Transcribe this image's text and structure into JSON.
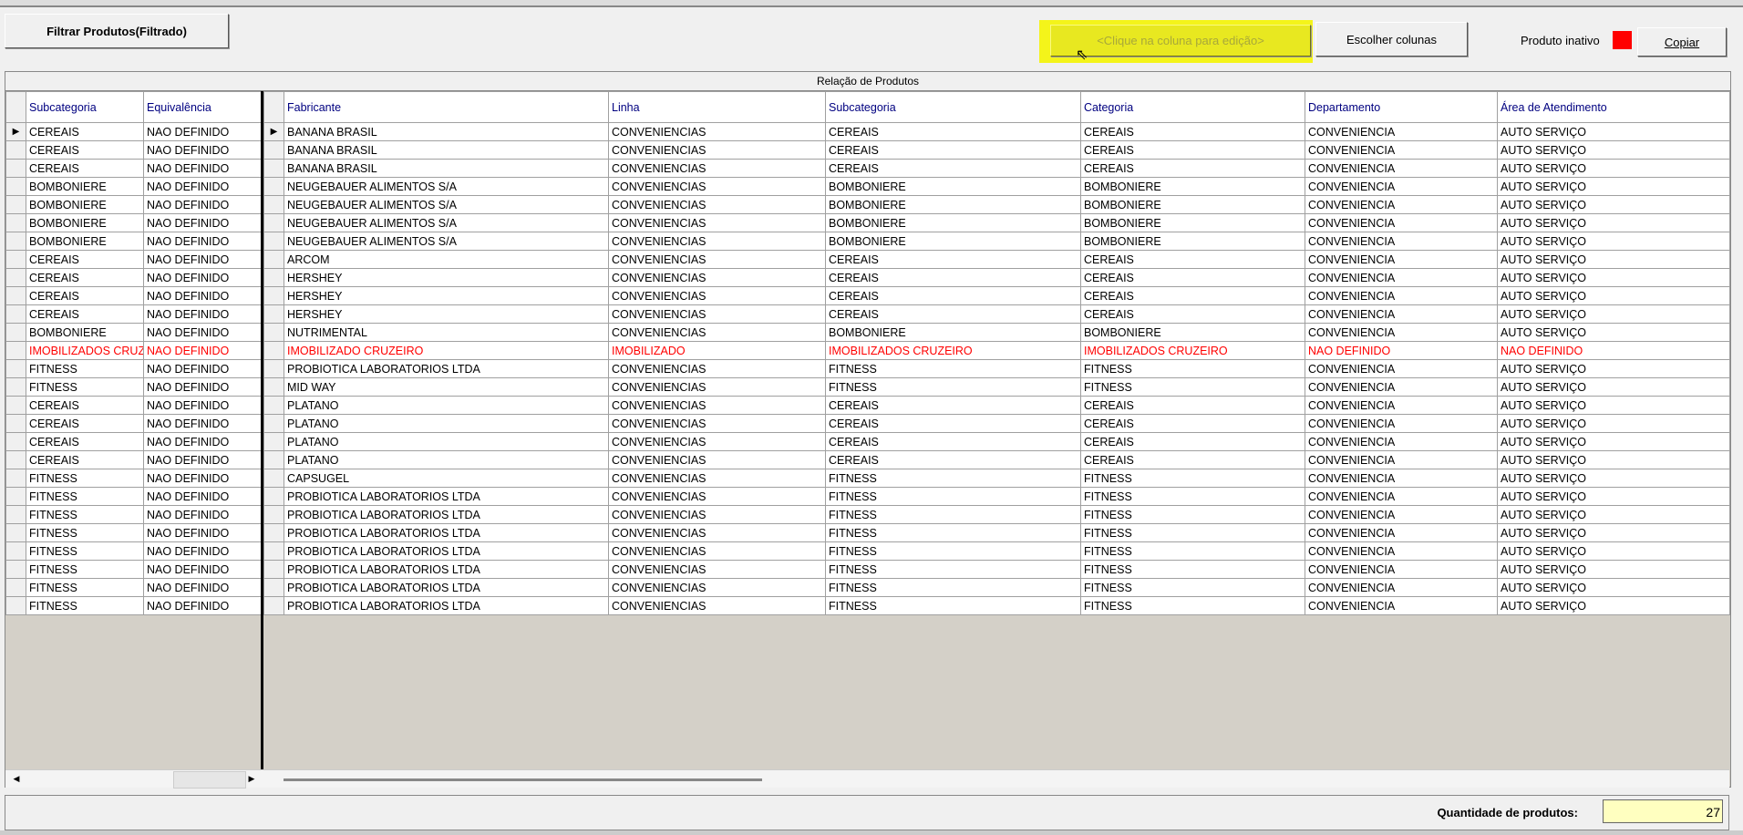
{
  "toolbar": {
    "filter_label": "Filtrar Produtos(Filtrado)",
    "edit_hint": "<Clique na coluna para edição>",
    "choose_columns": "Escolher colunas",
    "inactive_label": "Produto inativo",
    "inactive_color": "#ff0000",
    "copy_label": "Copiar"
  },
  "grid": {
    "title": "Relação de Produtos",
    "fixed_headers": [
      "Subcategoria",
      "Equivalência"
    ],
    "headers": [
      "Fabricante",
      "Linha",
      "Subcategoria",
      "Categoria",
      "Departamento",
      "Área de Atendimento"
    ],
    "rows": [
      [
        "CEREAIS",
        "NAO DEFINIDO",
        "BANANA BRASIL",
        "CONVENIENCIAS",
        "CEREAIS",
        "CEREAIS",
        "CONVENIENCIA",
        "AUTO SERVIÇO"
      ],
      [
        "CEREAIS",
        "NAO DEFINIDO",
        "BANANA BRASIL",
        "CONVENIENCIAS",
        "CEREAIS",
        "CEREAIS",
        "CONVENIENCIA",
        "AUTO SERVIÇO"
      ],
      [
        "CEREAIS",
        "NAO DEFINIDO",
        "BANANA BRASIL",
        "CONVENIENCIAS",
        "CEREAIS",
        "CEREAIS",
        "CONVENIENCIA",
        "AUTO SERVIÇO"
      ],
      [
        "BOMBONIERE",
        "NAO DEFINIDO",
        "NEUGEBAUER ALIMENTOS S/A",
        "CONVENIENCIAS",
        "BOMBONIERE",
        "BOMBONIERE",
        "CONVENIENCIA",
        "AUTO SERVIÇO"
      ],
      [
        "BOMBONIERE",
        "NAO DEFINIDO",
        "NEUGEBAUER ALIMENTOS S/A",
        "CONVENIENCIAS",
        "BOMBONIERE",
        "BOMBONIERE",
        "CONVENIENCIA",
        "AUTO SERVIÇO"
      ],
      [
        "BOMBONIERE",
        "NAO DEFINIDO",
        "NEUGEBAUER ALIMENTOS S/A",
        "CONVENIENCIAS",
        "BOMBONIERE",
        "BOMBONIERE",
        "CONVENIENCIA",
        "AUTO SERVIÇO"
      ],
      [
        "BOMBONIERE",
        "NAO DEFINIDO",
        "NEUGEBAUER ALIMENTOS S/A",
        "CONVENIENCIAS",
        "BOMBONIERE",
        "BOMBONIERE",
        "CONVENIENCIA",
        "AUTO SERVIÇO"
      ],
      [
        "CEREAIS",
        "NAO DEFINIDO",
        "ARCOM",
        "CONVENIENCIAS",
        "CEREAIS",
        "CEREAIS",
        "CONVENIENCIA",
        "AUTO SERVIÇO"
      ],
      [
        "CEREAIS",
        "NAO DEFINIDO",
        "HERSHEY",
        "CONVENIENCIAS",
        "CEREAIS",
        "CEREAIS",
        "CONVENIENCIA",
        "AUTO SERVIÇO"
      ],
      [
        "CEREAIS",
        "NAO DEFINIDO",
        "HERSHEY",
        "CONVENIENCIAS",
        "CEREAIS",
        "CEREAIS",
        "CONVENIENCIA",
        "AUTO SERVIÇO"
      ],
      [
        "CEREAIS",
        "NAO DEFINIDO",
        "HERSHEY",
        "CONVENIENCIAS",
        "CEREAIS",
        "CEREAIS",
        "CONVENIENCIA",
        "AUTO SERVIÇO"
      ],
      [
        "BOMBONIERE",
        "NAO DEFINIDO",
        "NUTRIMENTAL",
        "CONVENIENCIAS",
        "BOMBONIERE",
        "BOMBONIERE",
        "CONVENIENCIA",
        "AUTO SERVIÇO"
      ],
      [
        "IMOBILIZADOS CRUZEIRO",
        "NAO DEFINIDO",
        "IMOBILIZADO CRUZEIRO",
        "IMOBILIZADO",
        "IMOBILIZADOS CRUZEIRO",
        "IMOBILIZADOS CRUZEIRO",
        "NAO DEFINIDO",
        "NAO DEFINIDO"
      ],
      [
        "FITNESS",
        "NAO DEFINIDO",
        "PROBIOTICA LABORATORIOS LTDA",
        "CONVENIENCIAS",
        "FITNESS",
        "FITNESS",
        "CONVENIENCIA",
        "AUTO SERVIÇO"
      ],
      [
        "FITNESS",
        "NAO DEFINIDO",
        "MID WAY",
        "CONVENIENCIAS",
        "FITNESS",
        "FITNESS",
        "CONVENIENCIA",
        "AUTO SERVIÇO"
      ],
      [
        "CEREAIS",
        "NAO DEFINIDO",
        "PLATANO",
        "CONVENIENCIAS",
        "CEREAIS",
        "CEREAIS",
        "CONVENIENCIA",
        "AUTO SERVIÇO"
      ],
      [
        "CEREAIS",
        "NAO DEFINIDO",
        "PLATANO",
        "CONVENIENCIAS",
        "CEREAIS",
        "CEREAIS",
        "CONVENIENCIA",
        "AUTO SERVIÇO"
      ],
      [
        "CEREAIS",
        "NAO DEFINIDO",
        "PLATANO",
        "CONVENIENCIAS",
        "CEREAIS",
        "CEREAIS",
        "CONVENIENCIA",
        "AUTO SERVIÇO"
      ],
      [
        "CEREAIS",
        "NAO DEFINIDO",
        "PLATANO",
        "CONVENIENCIAS",
        "CEREAIS",
        "CEREAIS",
        "CONVENIENCIA",
        "AUTO SERVIÇO"
      ],
      [
        "FITNESS",
        "NAO DEFINIDO",
        "CAPSUGEL",
        "CONVENIENCIAS",
        "FITNESS",
        "FITNESS",
        "CONVENIENCIA",
        "AUTO SERVIÇO"
      ],
      [
        "FITNESS",
        "NAO DEFINIDO",
        "PROBIOTICA LABORATORIOS LTDA",
        "CONVENIENCIAS",
        "FITNESS",
        "FITNESS",
        "CONVENIENCIA",
        "AUTO SERVIÇO"
      ],
      [
        "FITNESS",
        "NAO DEFINIDO",
        "PROBIOTICA LABORATORIOS LTDA",
        "CONVENIENCIAS",
        "FITNESS",
        "FITNESS",
        "CONVENIENCIA",
        "AUTO SERVIÇO"
      ],
      [
        "FITNESS",
        "NAO DEFINIDO",
        "PROBIOTICA LABORATORIOS LTDA",
        "CONVENIENCIAS",
        "FITNESS",
        "FITNESS",
        "CONVENIENCIA",
        "AUTO SERVIÇO"
      ],
      [
        "FITNESS",
        "NAO DEFINIDO",
        "PROBIOTICA LABORATORIOS LTDA",
        "CONVENIENCIAS",
        "FITNESS",
        "FITNESS",
        "CONVENIENCIA",
        "AUTO SERVIÇO"
      ],
      [
        "FITNESS",
        "NAO DEFINIDO",
        "PROBIOTICA LABORATORIOS LTDA",
        "CONVENIENCIAS",
        "FITNESS",
        "FITNESS",
        "CONVENIENCIA",
        "AUTO SERVIÇO"
      ],
      [
        "FITNESS",
        "NAO DEFINIDO",
        "PROBIOTICA LABORATORIOS LTDA",
        "CONVENIENCIAS",
        "FITNESS",
        "FITNESS",
        "CONVENIENCIA",
        "AUTO SERVIÇO"
      ],
      [
        "FITNESS",
        "NAO DEFINIDO",
        "PROBIOTICA LABORATORIOS LTDA",
        "CONVENIENCIAS",
        "FITNESS",
        "FITNESS",
        "CONVENIENCIA",
        "AUTO SERVIÇO"
      ]
    ],
    "inactive_rows": [
      12
    ],
    "selected_row": 0
  },
  "footer": {
    "quantity_label": "Quantidade de produtos:",
    "quantity_value": "27"
  }
}
